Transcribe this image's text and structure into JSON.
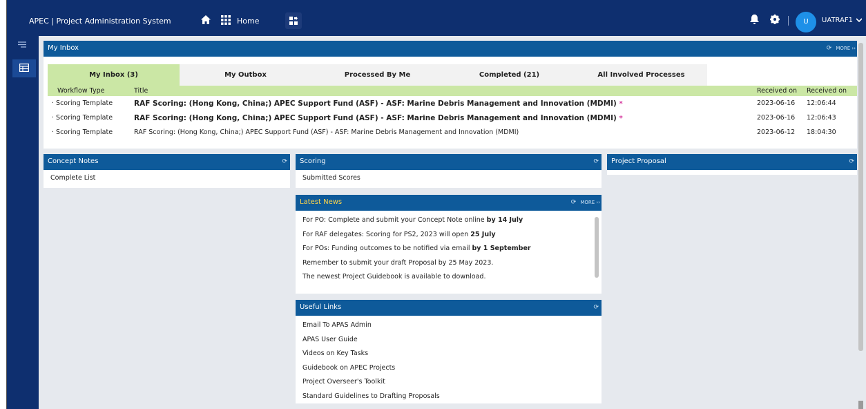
{
  "header": {
    "app_title": "APEC | Project Administration System",
    "home_label": "Home",
    "user_initial": "U",
    "user_name": "UATRAF1"
  },
  "inbox": {
    "title": "My Inbox",
    "more": "MORE",
    "tabs": [
      "My Inbox (3)",
      "My Outbox",
      "Processed By Me",
      "Completed (21)",
      "All Involved Processes"
    ],
    "columns": [
      "Workflow Type",
      "Title",
      "Received on",
      "Received on"
    ],
    "rows": [
      {
        "type": "Scoring Template",
        "title": "RAF Scoring: (Hong Kong, China;) APEC Support Fund (ASF) - ASF: Marine Debris Management and Innovation (MDMI)",
        "marker": "*",
        "date": "2023-06-16",
        "time": "12:06:44"
      },
      {
        "type": "Scoring Template",
        "title": "RAF Scoring: (Hong Kong, China;) APEC Support Fund (ASF) - ASF: Marine Debris Management and Innovation (MDMI)",
        "marker": "*",
        "date": "2023-06-16",
        "time": "12:06:43"
      },
      {
        "type": "Scoring Template",
        "title": "RAF Scoring: (Hong Kong, China;) APEC Support Fund (ASF) - ASF: Marine Debris Management and Innovation (MDMI)",
        "marker": "",
        "date": "2023-06-12",
        "time": "18:04:30"
      }
    ]
  },
  "concept_notes": {
    "title": "Concept Notes",
    "items": [
      "Complete List"
    ]
  },
  "scoring": {
    "title": "Scoring",
    "items": [
      "Submitted Scores"
    ]
  },
  "project_proposal": {
    "title": "Project Proposal"
  },
  "latest_news": {
    "title": "Latest News",
    "more": "MORE",
    "items": [
      {
        "text": "For PO: Complete and submit your Concept Note online ",
        "bold": "by 14 July"
      },
      {
        "text": "For RAF delegates: Scoring for PS2, 2023 will open ",
        "bold": "25 July"
      },
      {
        "text": "For POs: Funding outcomes to be notified via email ",
        "bold": "by 1 September"
      },
      {
        "text": "Remember to submit your draft Proposal by 25 May 2023.",
        "bold": ""
      },
      {
        "text": "The newest Project Guidebook is available to download.",
        "bold": ""
      }
    ]
  },
  "useful_links": {
    "title": "Useful Links",
    "items": [
      "Email To APAS Admin",
      "APAS User Guide",
      "Videos on Key Tasks",
      "Guidebook on APEC Projects",
      "Project Overseer's Toolkit",
      "Standard Guidelines to Drafting Proposals"
    ]
  },
  "colors": {
    "navbar": "#0e2f6f",
    "panel_header": "#0e5a9a",
    "active_tab": "#cbe7a5",
    "news_title": "#ffd54a",
    "unread_marker": "#d4379c"
  }
}
